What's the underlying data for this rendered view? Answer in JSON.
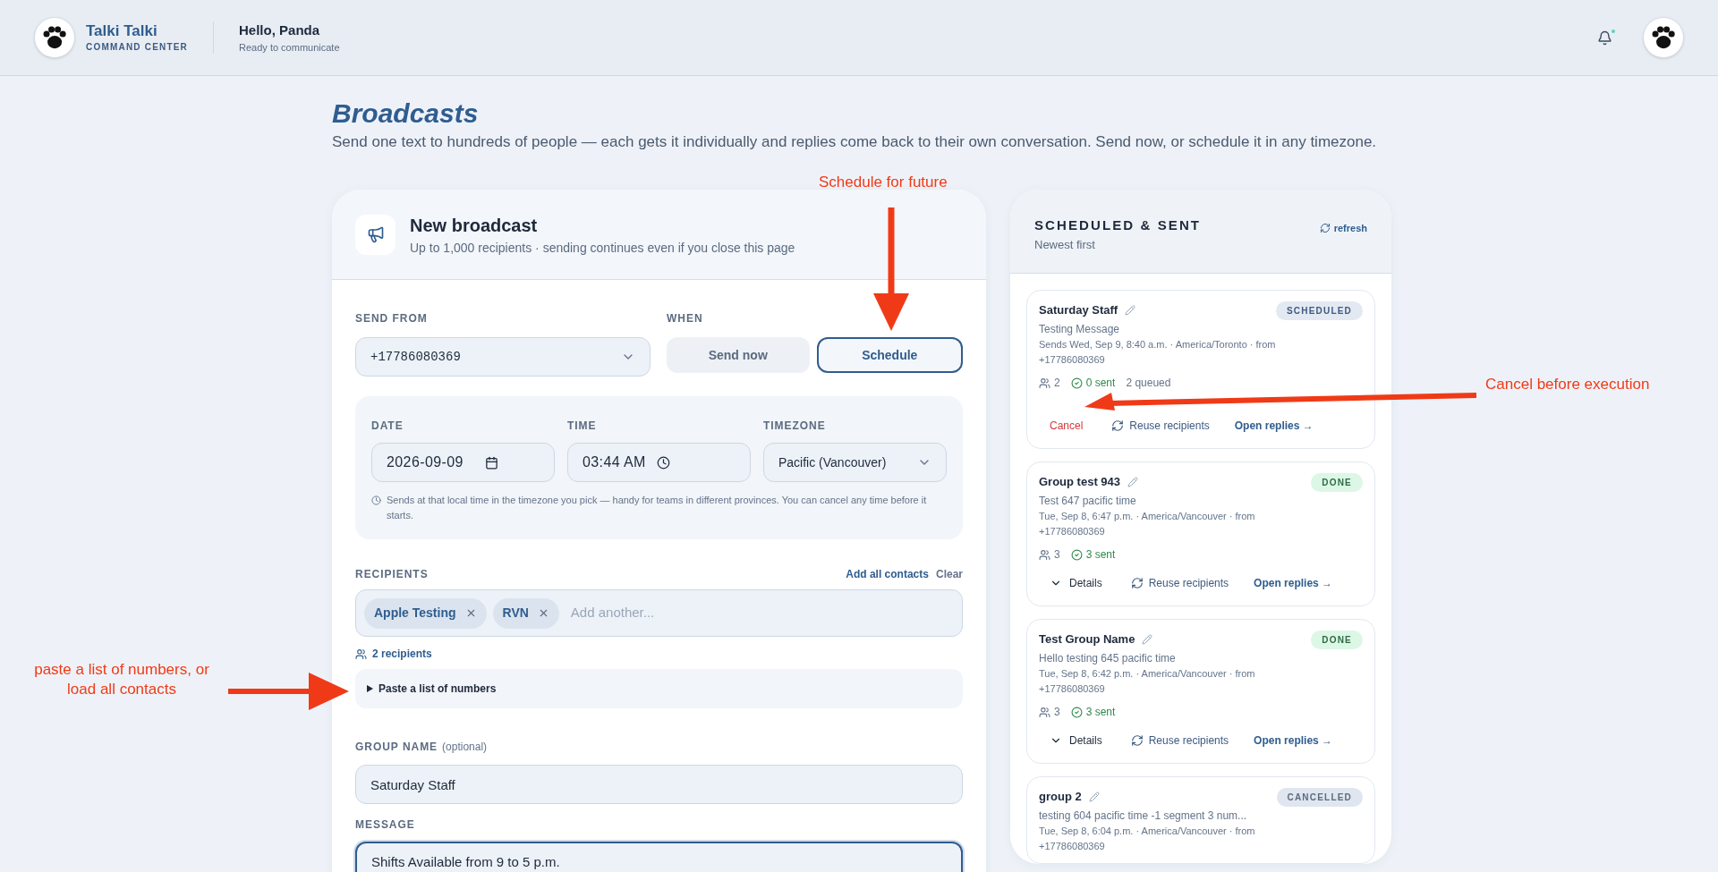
{
  "header": {
    "brand_name": "Talki Talki",
    "brand_sub": "COMMAND CENTER",
    "greeting": "Hello, Panda",
    "status": "Ready to communicate",
    "has_unread": true
  },
  "page": {
    "title": "Broadcasts",
    "description": "Send one text to hundreds of people — each gets it individually and replies come back to their own conversation. Send now, or schedule it in any timezone."
  },
  "composer": {
    "title": "New broadcast",
    "subtitle": "Up to 1,000 recipients · sending continues even if you close this page",
    "send_from": {
      "label": "SEND FROM",
      "value": "+17786080369"
    },
    "when": {
      "label": "WHEN",
      "options": [
        {
          "label": "Send now",
          "selected": false
        },
        {
          "label": "Schedule",
          "selected": true
        }
      ]
    },
    "schedule": {
      "date_label": "DATE",
      "date": "2026-09-09",
      "time_label": "TIME",
      "time": "03:44 AM",
      "timezone_label": "TIMEZONE",
      "timezone": "Pacific (Vancouver)",
      "hint": "Sends at that local time in the timezone you pick — handy for teams in different provinces. You can cancel any time before it starts."
    },
    "recipients": {
      "label": "RECIPIENTS",
      "actions": [
        {
          "label": "Add all contacts",
          "kind": "primary"
        },
        {
          "label": "Clear",
          "kind": "muted"
        }
      ],
      "chips": [
        "Apple Testing",
        "RVN"
      ],
      "placeholder": "Add another...",
      "count": "2 recipients",
      "paste_toggle": "Paste a list of numbers",
      "paste_expanded": false
    },
    "group_name": {
      "label": "GROUP NAME",
      "note": "(optional)",
      "value": "Saturday Staff"
    },
    "message": {
      "label": "MESSAGE",
      "value": "Shifts Available from 9 to 5 p.m.",
      "focused": true
    }
  },
  "history": {
    "title": "SCHEDULED & SENT",
    "subtitle": "Newest first",
    "refresh": "refresh",
    "items": [
      {
        "name": "Saturday Staff",
        "status": "SCHEDULED",
        "kind": "scheduled",
        "message": "Testing Message",
        "meta": "Sends Wed, Sep 9, 8:40 a.m. · America/Toronto · from +17786080369",
        "recipients": "2",
        "sent": "0 sent",
        "queued": "2 queued",
        "actions": [
          {
            "label": "Cancel",
            "kind": "cancel"
          },
          {
            "label": "Reuse recipients",
            "kind": "reuse"
          },
          {
            "label": "Open replies →",
            "kind": "open"
          }
        ]
      },
      {
        "name": "Group test 943",
        "status": "DONE",
        "kind": "done",
        "message": "Test 647 pacific time",
        "meta": "Tue, Sep 8, 6:47 p.m. · America/Vancouver · from +17786080369",
        "recipients": "3",
        "sent": "3 sent",
        "actions": [
          {
            "label": "Details",
            "kind": "details"
          },
          {
            "label": "Reuse recipients",
            "kind": "reuse"
          },
          {
            "label": "Open replies →",
            "kind": "open"
          }
        ]
      },
      {
        "name": "Test Group Name",
        "status": "DONE",
        "kind": "done",
        "message": "Hello testing 645 pacific time",
        "meta": "Tue, Sep 8, 6:42 p.m. · America/Vancouver · from +17786080369",
        "recipients": "3",
        "sent": "3 sent",
        "actions": [
          {
            "label": "Details",
            "kind": "details"
          },
          {
            "label": "Reuse recipients",
            "kind": "reuse"
          },
          {
            "label": "Open replies →",
            "kind": "open"
          }
        ]
      },
      {
        "name": "group 2",
        "status": "CANCELLED",
        "kind": "cancelled",
        "message": "testing 604 pacific time -1 segment 3 num...",
        "meta": "Tue, Sep 8, 6:04 p.m. · America/Vancouver · from +17786080369"
      }
    ]
  },
  "annotations": [
    {
      "text": "Schedule for future",
      "kind": "down"
    },
    {
      "text": "Cancel before execution",
      "kind": "left"
    },
    {
      "text": "paste a list of numbers, or load all contacts",
      "kind": "right"
    }
  ]
}
